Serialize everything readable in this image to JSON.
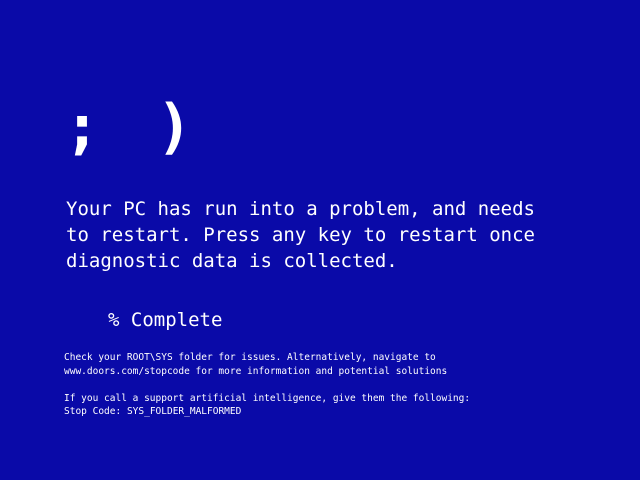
{
  "screen": {
    "background_color": "#0a0aa8",
    "text_color": "#ffffff",
    "emoticon": "; )",
    "message_lines": [
      "Your PC has run into a problem, and needs",
      "to restart. Press any key to restart once",
      "diagnostic data is collected."
    ],
    "progress_text": "% Complete",
    "details": {
      "check_lines": [
        "Check your ROOT\\SYS folder for issues. Alternatively, navigate to",
        "www.doors.com/stopcode for more information and potential solutions"
      ],
      "support_line": "If you call a support artificial intelligence, give them the following:",
      "stop_code_label": "Stop Code:",
      "stop_code": "SYS_FOLDER_MALFORMED"
    }
  }
}
